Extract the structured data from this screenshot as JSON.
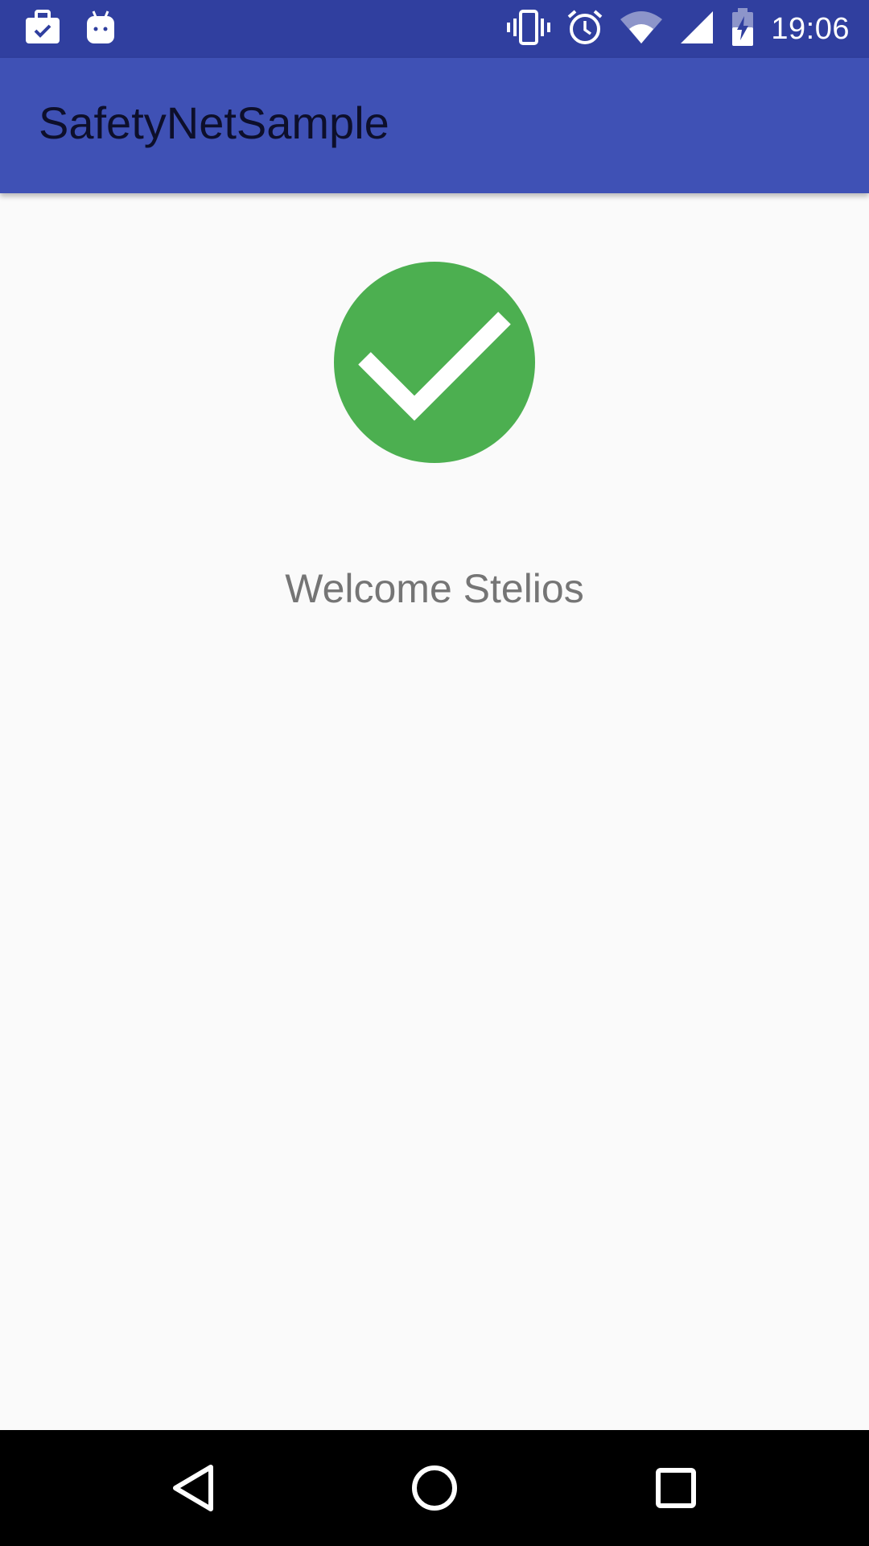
{
  "status_bar": {
    "time": "19:06",
    "left_icons": [
      "briefcase-check-icon",
      "android-robot-icon"
    ],
    "right_icons": [
      "vibrate-icon",
      "alarm-icon",
      "wifi-icon",
      "signal-icon",
      "battery-charging-icon"
    ]
  },
  "app_bar": {
    "title": "SafetyNetSample"
  },
  "main": {
    "status_icon": "check-circle-icon",
    "welcome_text": "Welcome Stelios"
  },
  "nav_bar": {
    "buttons": [
      "back-icon",
      "home-icon",
      "recents-icon"
    ]
  },
  "colors": {
    "status_bar": "#303f9f",
    "app_bar": "#3f51b5",
    "success": "#4caf50",
    "background": "#fafafa",
    "text_secondary": "#757575"
  }
}
